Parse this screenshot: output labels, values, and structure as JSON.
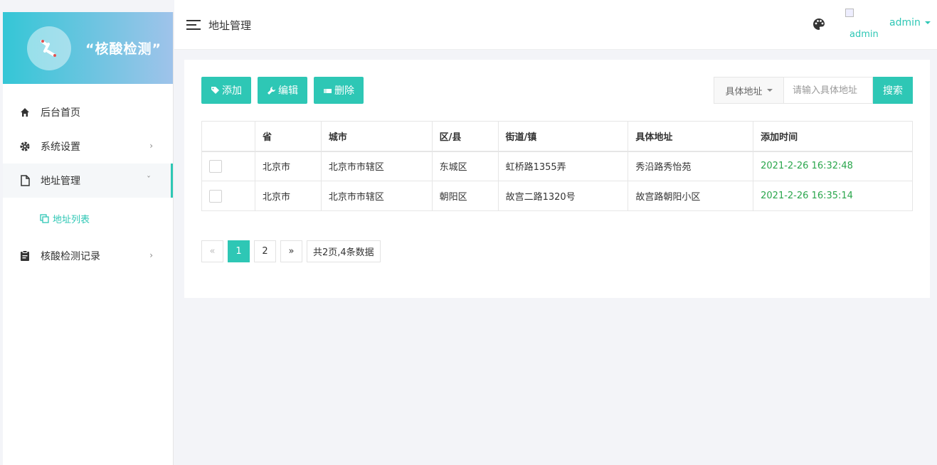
{
  "brand": {
    "title": "“核酸检测”"
  },
  "sidebar": {
    "items": [
      {
        "label": "后台首页"
      },
      {
        "label": "系统设置"
      },
      {
        "label": "地址管理",
        "children": [
          {
            "label": "地址列表"
          }
        ]
      },
      {
        "label": "核酸检测记录"
      }
    ]
  },
  "header": {
    "title": "地址管理",
    "avatar_alt": "admin",
    "user": "admin"
  },
  "toolbar": {
    "add": "添加",
    "edit": "编辑",
    "delete": "删除"
  },
  "search": {
    "field": "具体地址",
    "placeholder": "请输入具体地址",
    "button": "搜索"
  },
  "table": {
    "headers": [
      "省",
      "城市",
      "区/县",
      "街道/镇",
      "具体地址",
      "添加时间"
    ],
    "rows": [
      [
        "北京市",
        "北京市市辖区",
        "东城区",
        "虹桥路1355弄",
        "秀沿路秀怡苑",
        "2021-2-26 16:32:48"
      ],
      [
        "北京市",
        "北京市市辖区",
        "朝阳区",
        "故宫二路1320号",
        "故宫路朝阳小区",
        "2021-2-26 16:35:14"
      ]
    ]
  },
  "pagination": {
    "prev": "«",
    "pages": [
      "1",
      "2"
    ],
    "current": "1",
    "next": "»",
    "info": "共2页,4条数据"
  },
  "colors": {
    "accent": "#2ec7b5",
    "time": "#2aa64c"
  }
}
